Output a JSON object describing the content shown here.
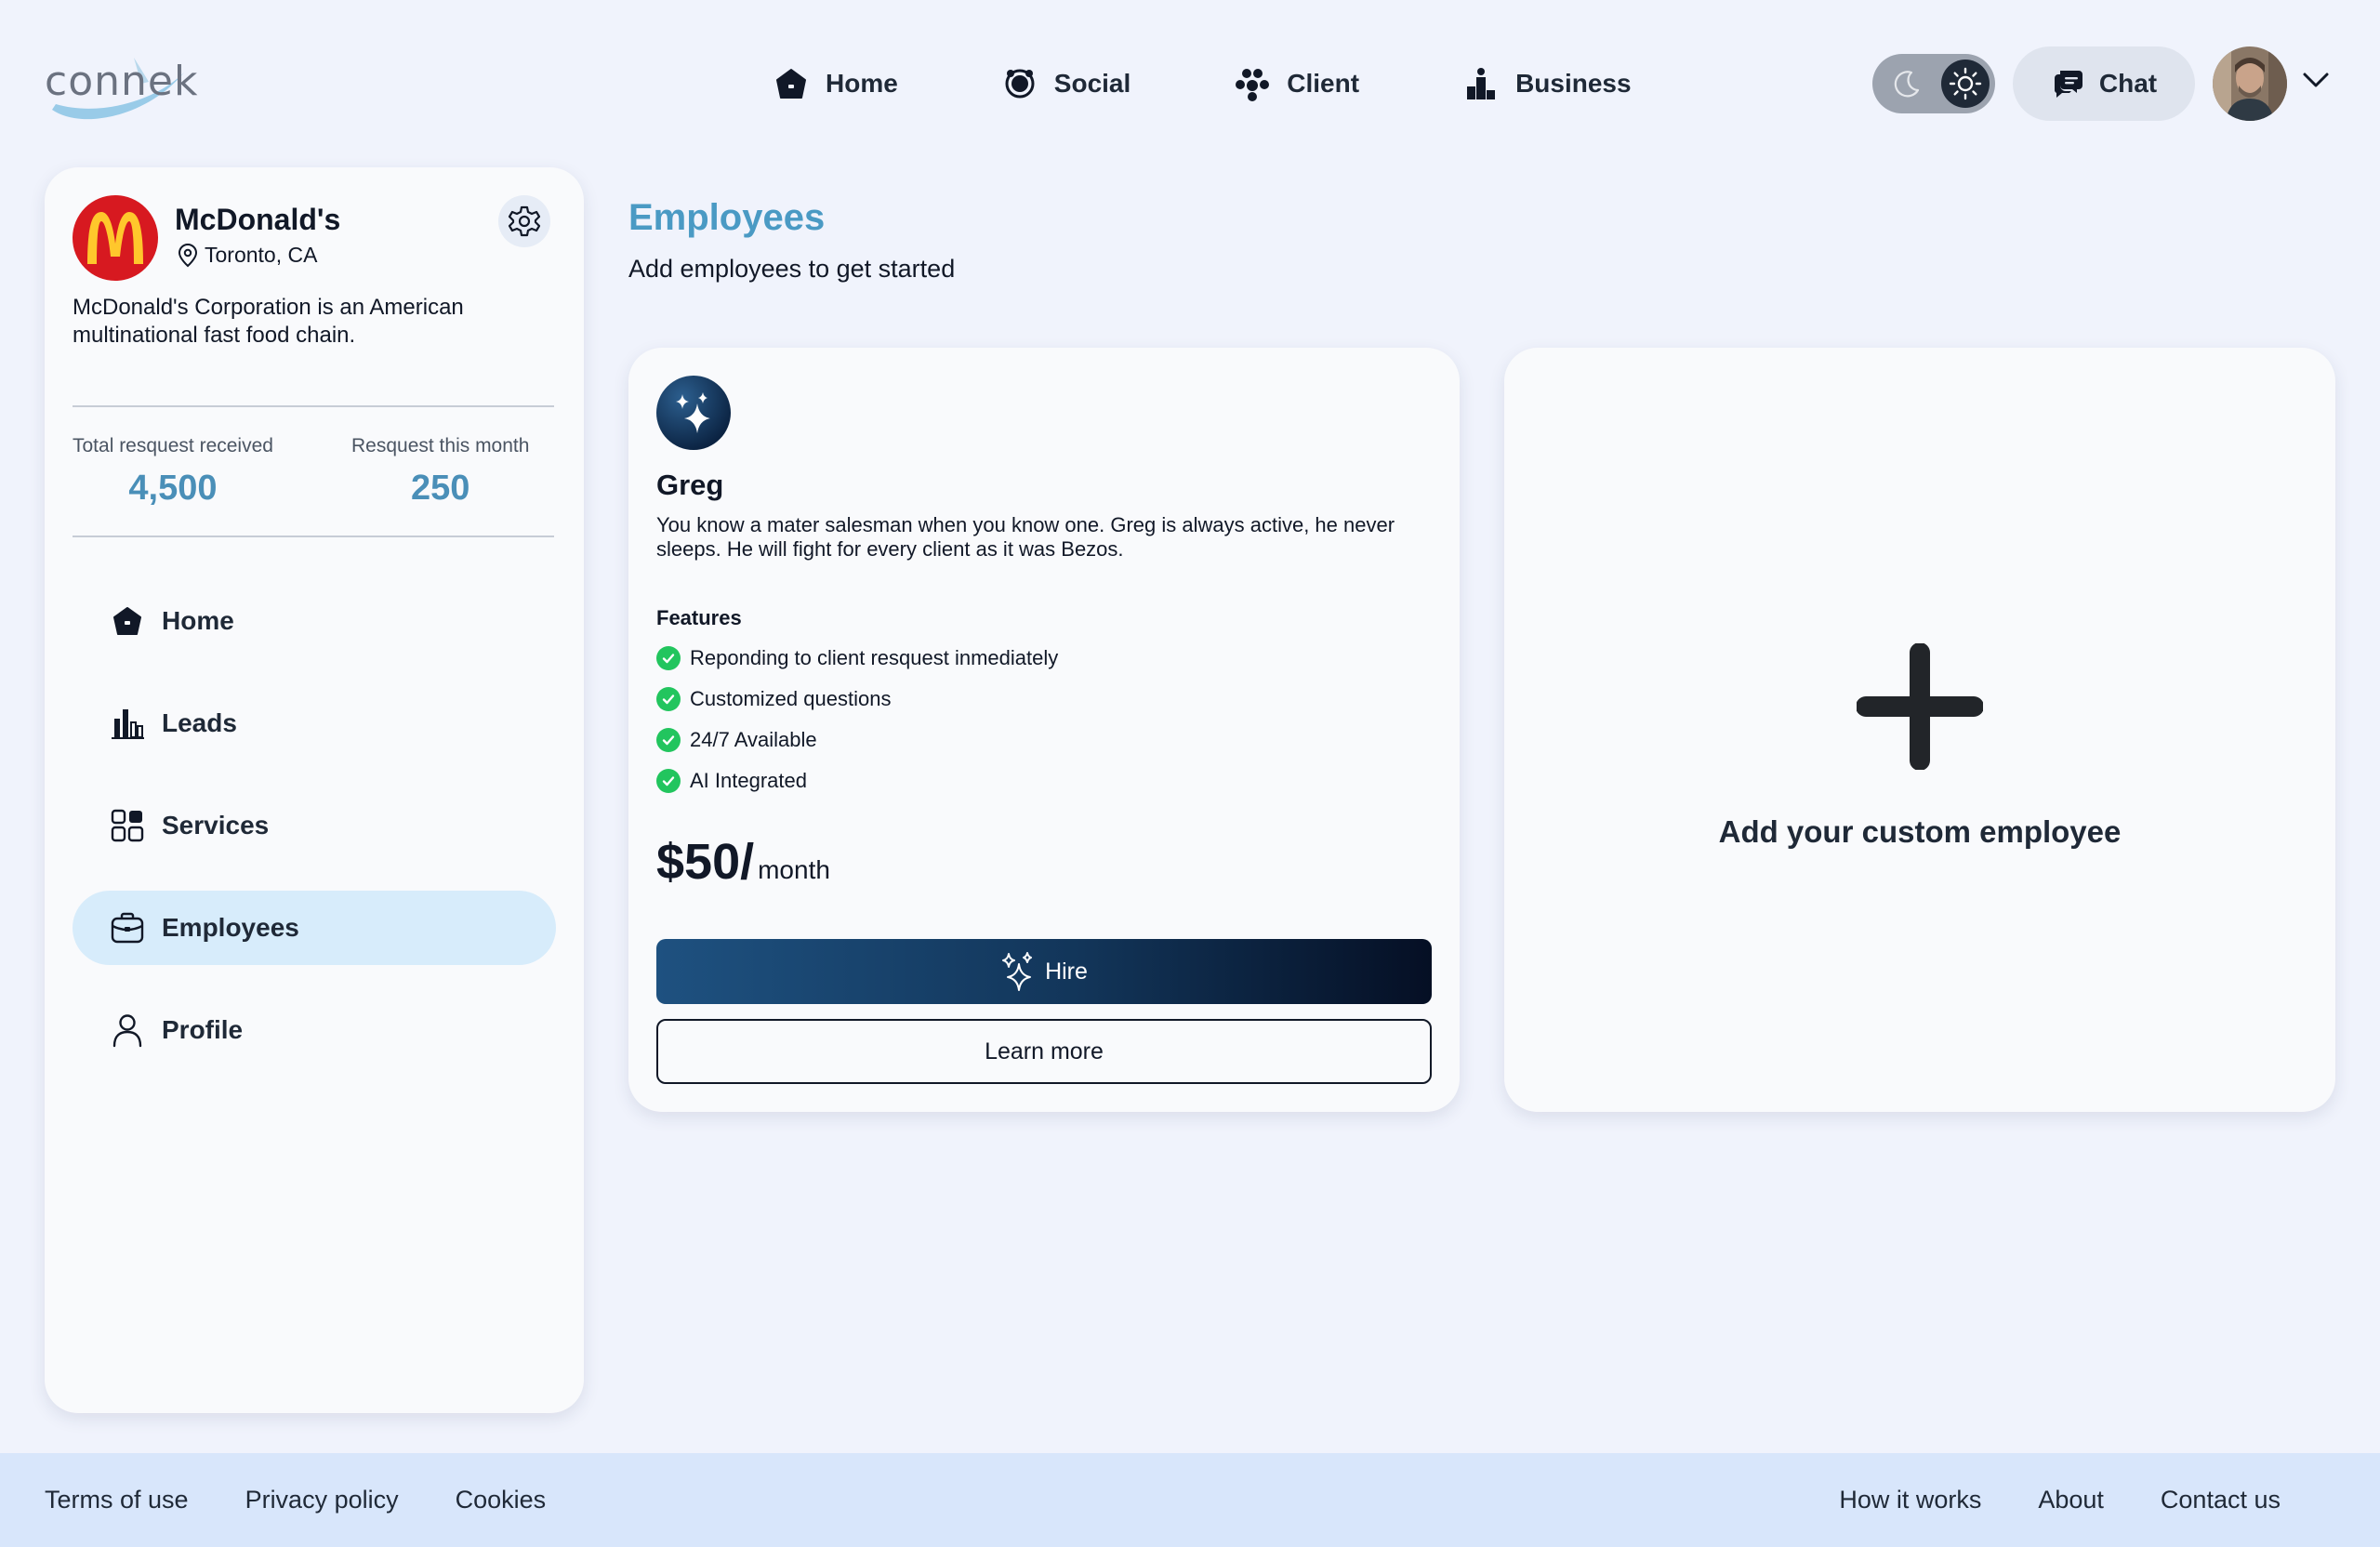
{
  "app": {
    "logo_text": "connek"
  },
  "top_nav": {
    "items": [
      {
        "label": "Home",
        "icon": "home-icon"
      },
      {
        "label": "Social",
        "icon": "social-icon"
      },
      {
        "label": "Client",
        "icon": "client-icon"
      },
      {
        "label": "Business",
        "icon": "business-icon"
      }
    ],
    "theme_toggle": {
      "state": "dark",
      "icons": [
        "moon-icon",
        "sun-icon"
      ]
    },
    "chat_label": "Chat"
  },
  "sidebar": {
    "company": {
      "name": "McDonald's",
      "location": "Toronto, CA",
      "description": "McDonald's Corporation is an American multinational fast food chain.",
      "brand_color": "#d71920",
      "logo_color": "#ffc72c"
    },
    "stats": [
      {
        "label": "Total resquest received",
        "value": "4,500"
      },
      {
        "label": "Resquest this month",
        "value": "250"
      }
    ],
    "nav": [
      {
        "label": "Home",
        "icon": "home-icon",
        "active": false
      },
      {
        "label": "Leads",
        "icon": "leads-chart-icon",
        "active": false
      },
      {
        "label": "Services",
        "icon": "services-grid-icon",
        "active": false
      },
      {
        "label": "Employees",
        "icon": "briefcase-icon",
        "active": true
      },
      {
        "label": "Profile",
        "icon": "user-icon",
        "active": false
      }
    ]
  },
  "main": {
    "title": "Employees",
    "subtitle": "Add employees to get started",
    "employee_card": {
      "name": "Greg",
      "description": "You know a mater salesman when you know one. Greg is always active, he never sleeps. He will fight for every client as it was Bezos.",
      "features_title": "Features",
      "features": [
        "Reponding to client resquest inmediately",
        "Customized questions",
        "24/7 Available",
        "AI Integrated"
      ],
      "price": "$50/",
      "price_unit": "month",
      "hire_label": "Hire",
      "learn_more_label": "Learn more"
    },
    "add_card": {
      "label": "Add your custom employee"
    }
  },
  "footer": {
    "left_links": [
      "Terms of use",
      "Privacy policy",
      "Cookies"
    ],
    "right_links": [
      "How it works",
      "About",
      "Contact us"
    ]
  },
  "colors": {
    "accent": "#4a9ac4",
    "active_nav_bg": "#d7ecfb",
    "check_green": "#22c55e",
    "footer_bg": "#d8e6fb"
  }
}
